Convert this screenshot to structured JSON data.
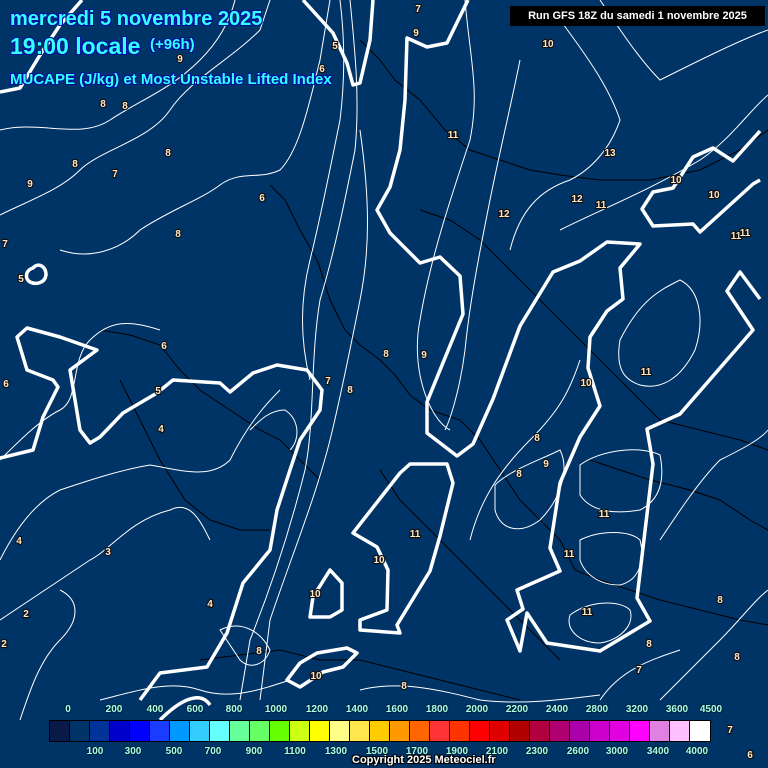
{
  "header": {
    "date": "mercredi 5 novembre 2025",
    "time": "19:00 locale",
    "lead": "(+96h)",
    "parameter": "MUCAPE (J/kg) et Most Unstable Lifted Index",
    "run": "Run GFS 18Z du samedi 1 novembre 2025"
  },
  "map": {
    "background_color": "#003366",
    "contour_labels": [
      "7",
      "9",
      "10",
      "5",
      "6",
      "9",
      "8",
      "8",
      "8",
      "8",
      "7",
      "9",
      "6",
      "11",
      "13",
      "12",
      "12",
      "11",
      "10",
      "10",
      "11",
      "11",
      "8",
      "7",
      "5",
      "6",
      "6",
      "8",
      "9",
      "7",
      "8",
      "5",
      "4",
      "10",
      "11",
      "8",
      "9",
      "8",
      "11",
      "11",
      "4",
      "3",
      "11",
      "10",
      "4",
      "10",
      "8",
      "11",
      "2",
      "2",
      "8",
      "8",
      "8",
      "7",
      "10",
      "8",
      "7",
      "6"
    ]
  },
  "legend": {
    "colors": [
      "#0a1a48",
      "#003366",
      "#003399",
      "#0000cc",
      "#0000ff",
      "#1a3cff",
      "#0099ff",
      "#33ccff",
      "#66ffff",
      "#66ff99",
      "#66ff66",
      "#66ff00",
      "#ccff11",
      "#ffff00",
      "#ffff88",
      "#ffe64d",
      "#ffcc00",
      "#ff9900",
      "#ff6600",
      "#ff3333",
      "#ff3300",
      "#ff0000",
      "#e00000",
      "#b00000",
      "#b00040",
      "#b00070",
      "#aa00aa",
      "#cc00cc",
      "#e000e0",
      "#ff00ff",
      "#e080e0",
      "#ffc0ff",
      "#ffffff"
    ],
    "top_labels": [
      "0",
      "200",
      "400",
      "600",
      "800",
      "1000",
      "1200",
      "1400",
      "1600",
      "1800",
      "2000",
      "2200",
      "2400",
      "2800",
      "3200",
      "3600",
      "4500"
    ],
    "bottom_labels": [
      "100",
      "300",
      "500",
      "700",
      "900",
      "1100",
      "1300",
      "1500",
      "1700",
      "1900",
      "2100",
      "2300",
      "2600",
      "3000",
      "3400",
      "4000"
    ]
  },
  "footer": {
    "copyright": "Copyright 2025 Meteociel.fr"
  }
}
